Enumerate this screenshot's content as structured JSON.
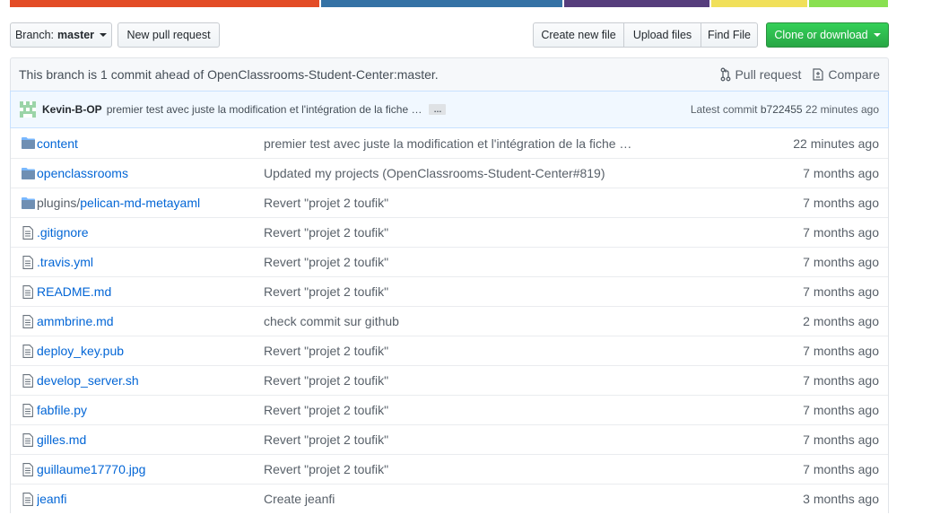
{
  "language_bar": [
    {
      "color": "#e34c26",
      "fraction": 0.355
    },
    {
      "color": "#3572A5",
      "fraction": 0.277
    },
    {
      "color": "#563d7c",
      "fraction": 0.167
    },
    {
      "color": "#f1e05a",
      "fraction": 0.11
    },
    {
      "color": "#89e051",
      "fraction": 0.091
    }
  ],
  "toolbar": {
    "branch_prefix": "Branch:",
    "branch_name": "master",
    "new_pull_request": "New pull request",
    "create_new_file": "Create new file",
    "upload_files": "Upload files",
    "find_file": "Find File",
    "clone_or_download": "Clone or download"
  },
  "branch_info": {
    "text": "This branch is 1 commit ahead of OpenClassrooms-Student-Center:master.",
    "pull_request": "Pull request",
    "compare": "Compare"
  },
  "latest_commit": {
    "author": "Kevin-B-OP",
    "message": "premier test avec juste la modification et l'intégration de la fiche …",
    "expander": "…",
    "label": "Latest commit",
    "sha": "b722455",
    "age": "22 minutes ago"
  },
  "files": [
    {
      "type": "dir",
      "prefix": "",
      "name": "content",
      "message": "premier test avec juste la modification et l'intégration de la fiche …",
      "age": "22 minutes ago"
    },
    {
      "type": "dir",
      "prefix": "",
      "name": "openclassrooms",
      "message": "Updated my projects (OpenClassrooms-Student-Center#819)",
      "age": "7 months ago"
    },
    {
      "type": "dir",
      "prefix": "plugins/",
      "name": "pelican-md-metayaml",
      "message": "Revert \"projet 2 toufik\"",
      "age": "7 months ago"
    },
    {
      "type": "file",
      "prefix": "",
      "name": ".gitignore",
      "message": "Revert \"projet 2 toufik\"",
      "age": "7 months ago"
    },
    {
      "type": "file",
      "prefix": "",
      "name": ".travis.yml",
      "message": "Revert \"projet 2 toufik\"",
      "age": "7 months ago"
    },
    {
      "type": "file",
      "prefix": "",
      "name": "README.md",
      "message": "Revert \"projet 2 toufik\"",
      "age": "7 months ago"
    },
    {
      "type": "file",
      "prefix": "",
      "name": "ammbrine.md",
      "message": "check commit sur github",
      "age": "2 months ago"
    },
    {
      "type": "file",
      "prefix": "",
      "name": "deploy_key.pub",
      "message": "Revert \"projet 2 toufik\"",
      "age": "7 months ago"
    },
    {
      "type": "file",
      "prefix": "",
      "name": "develop_server.sh",
      "message": "Revert \"projet 2 toufik\"",
      "age": "7 months ago"
    },
    {
      "type": "file",
      "prefix": "",
      "name": "fabfile.py",
      "message": "Revert \"projet 2 toufik\"",
      "age": "7 months ago"
    },
    {
      "type": "file",
      "prefix": "",
      "name": "gilles.md",
      "message": "Revert \"projet 2 toufik\"",
      "age": "7 months ago"
    },
    {
      "type": "file",
      "prefix": "",
      "name": "guillaume17770.jpg",
      "message": "Revert \"projet 2 toufik\"",
      "age": "7 months ago"
    },
    {
      "type": "file",
      "prefix": "",
      "name": "jeanfi",
      "message": "Create jeanfi",
      "age": "3 months ago"
    }
  ]
}
